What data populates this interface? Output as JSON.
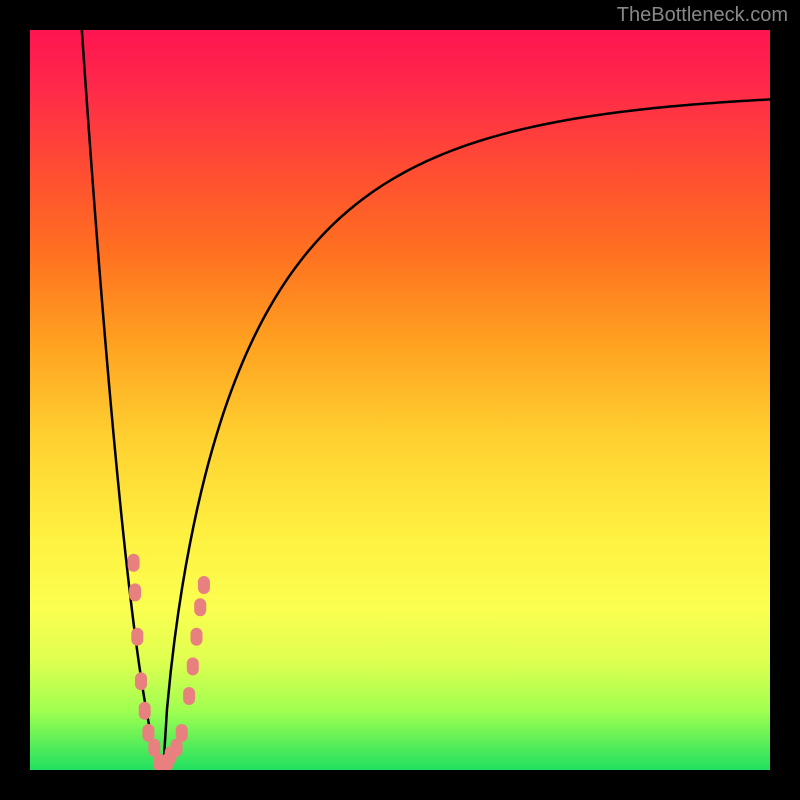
{
  "watermark": "TheBottleneck.com",
  "chart_data": {
    "type": "line",
    "title": "",
    "xlabel": "",
    "ylabel": "",
    "xlim": [
      0,
      100
    ],
    "ylim": [
      0,
      100
    ],
    "gradient_vertical": true,
    "gradient_colors_top_to_bottom": [
      "#ff1450",
      "#ff5030",
      "#ffa020",
      "#fff040",
      "#e0ff50",
      "#20e060"
    ],
    "curve": {
      "description": "V-shaped bottleneck curve with minimum near x=18; left branch steep falling from top-left, right branch rising asymptotically toward top-right",
      "minimum_x": 18,
      "minimum_y": 0,
      "left_start": {
        "x": 7,
        "y": 100
      },
      "right_end": {
        "x": 100,
        "y": 92
      }
    },
    "scatter_points": {
      "color": "#e98080",
      "points": [
        {
          "x": 14.0,
          "y": 28
        },
        {
          "x": 14.2,
          "y": 24
        },
        {
          "x": 14.5,
          "y": 18
        },
        {
          "x": 15.0,
          "y": 12
        },
        {
          "x": 15.5,
          "y": 8
        },
        {
          "x": 16.0,
          "y": 5
        },
        {
          "x": 16.8,
          "y": 3
        },
        {
          "x": 17.5,
          "y": 1
        },
        {
          "x": 18.5,
          "y": 1
        },
        {
          "x": 19.0,
          "y": 2
        },
        {
          "x": 19.8,
          "y": 3
        },
        {
          "x": 20.5,
          "y": 5
        },
        {
          "x": 21.5,
          "y": 10
        },
        {
          "x": 22.0,
          "y": 14
        },
        {
          "x": 22.5,
          "y": 18
        },
        {
          "x": 23.0,
          "y": 22
        },
        {
          "x": 23.5,
          "y": 25
        }
      ]
    }
  }
}
